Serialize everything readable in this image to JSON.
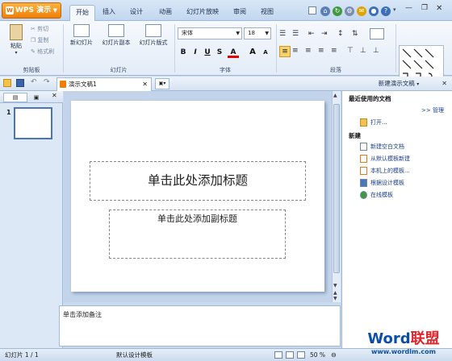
{
  "app": {
    "menu_label": "WPS 演示"
  },
  "tabs": [
    "开始",
    "插入",
    "设计",
    "动画",
    "幻灯片放映",
    "审阅",
    "视图"
  ],
  "clipboard": {
    "paste": "粘贴",
    "cut": "剪切",
    "copy": "复制",
    "format_painter": "格式刷",
    "group": "剪贴板"
  },
  "slides_group": {
    "new_slide": "新幻灯片",
    "copy_slide": "幻灯片副本",
    "layout": "幻灯片版式",
    "group": "幻灯片"
  },
  "font": {
    "name": "宋体",
    "size": "18",
    "bold": "B",
    "italic": "I",
    "underline": "U",
    "strike": "S",
    "color": "A",
    "grow": "A",
    "shrink": "A",
    "group": "字体"
  },
  "paragraph": {
    "group": "段落"
  },
  "document": {
    "tab_title": "演示文稿1"
  },
  "slide": {
    "title_placeholder": "单击此处添加标题",
    "subtitle_placeholder": "单击此处添加副标题",
    "thumbnail_number": "1"
  },
  "notes": {
    "placeholder": "单击添加备注"
  },
  "task_pane": {
    "title": "新建演示文稿",
    "recent_heading": "最近使用的文档",
    "manage": ">> 管理",
    "open": "打开...",
    "new_heading": "新建",
    "items": [
      "新建空白文档",
      "从默认模板新建",
      "本机上的模板...",
      "根据设计模板",
      "在线模板"
    ]
  },
  "status": {
    "slide_count": "幻灯片 1 / 1",
    "template": "默认设计模板",
    "zoom": "50 %"
  },
  "watermark": {
    "brand_a": "Word",
    "brand_b": "联盟",
    "url": "www.wordlm.com"
  },
  "colors": {
    "accent_orange": "#f07d05",
    "ribbon_blue": "#c2d7ef",
    "link_blue": "#1a3d8f",
    "watermark_red": "#e0262b"
  }
}
